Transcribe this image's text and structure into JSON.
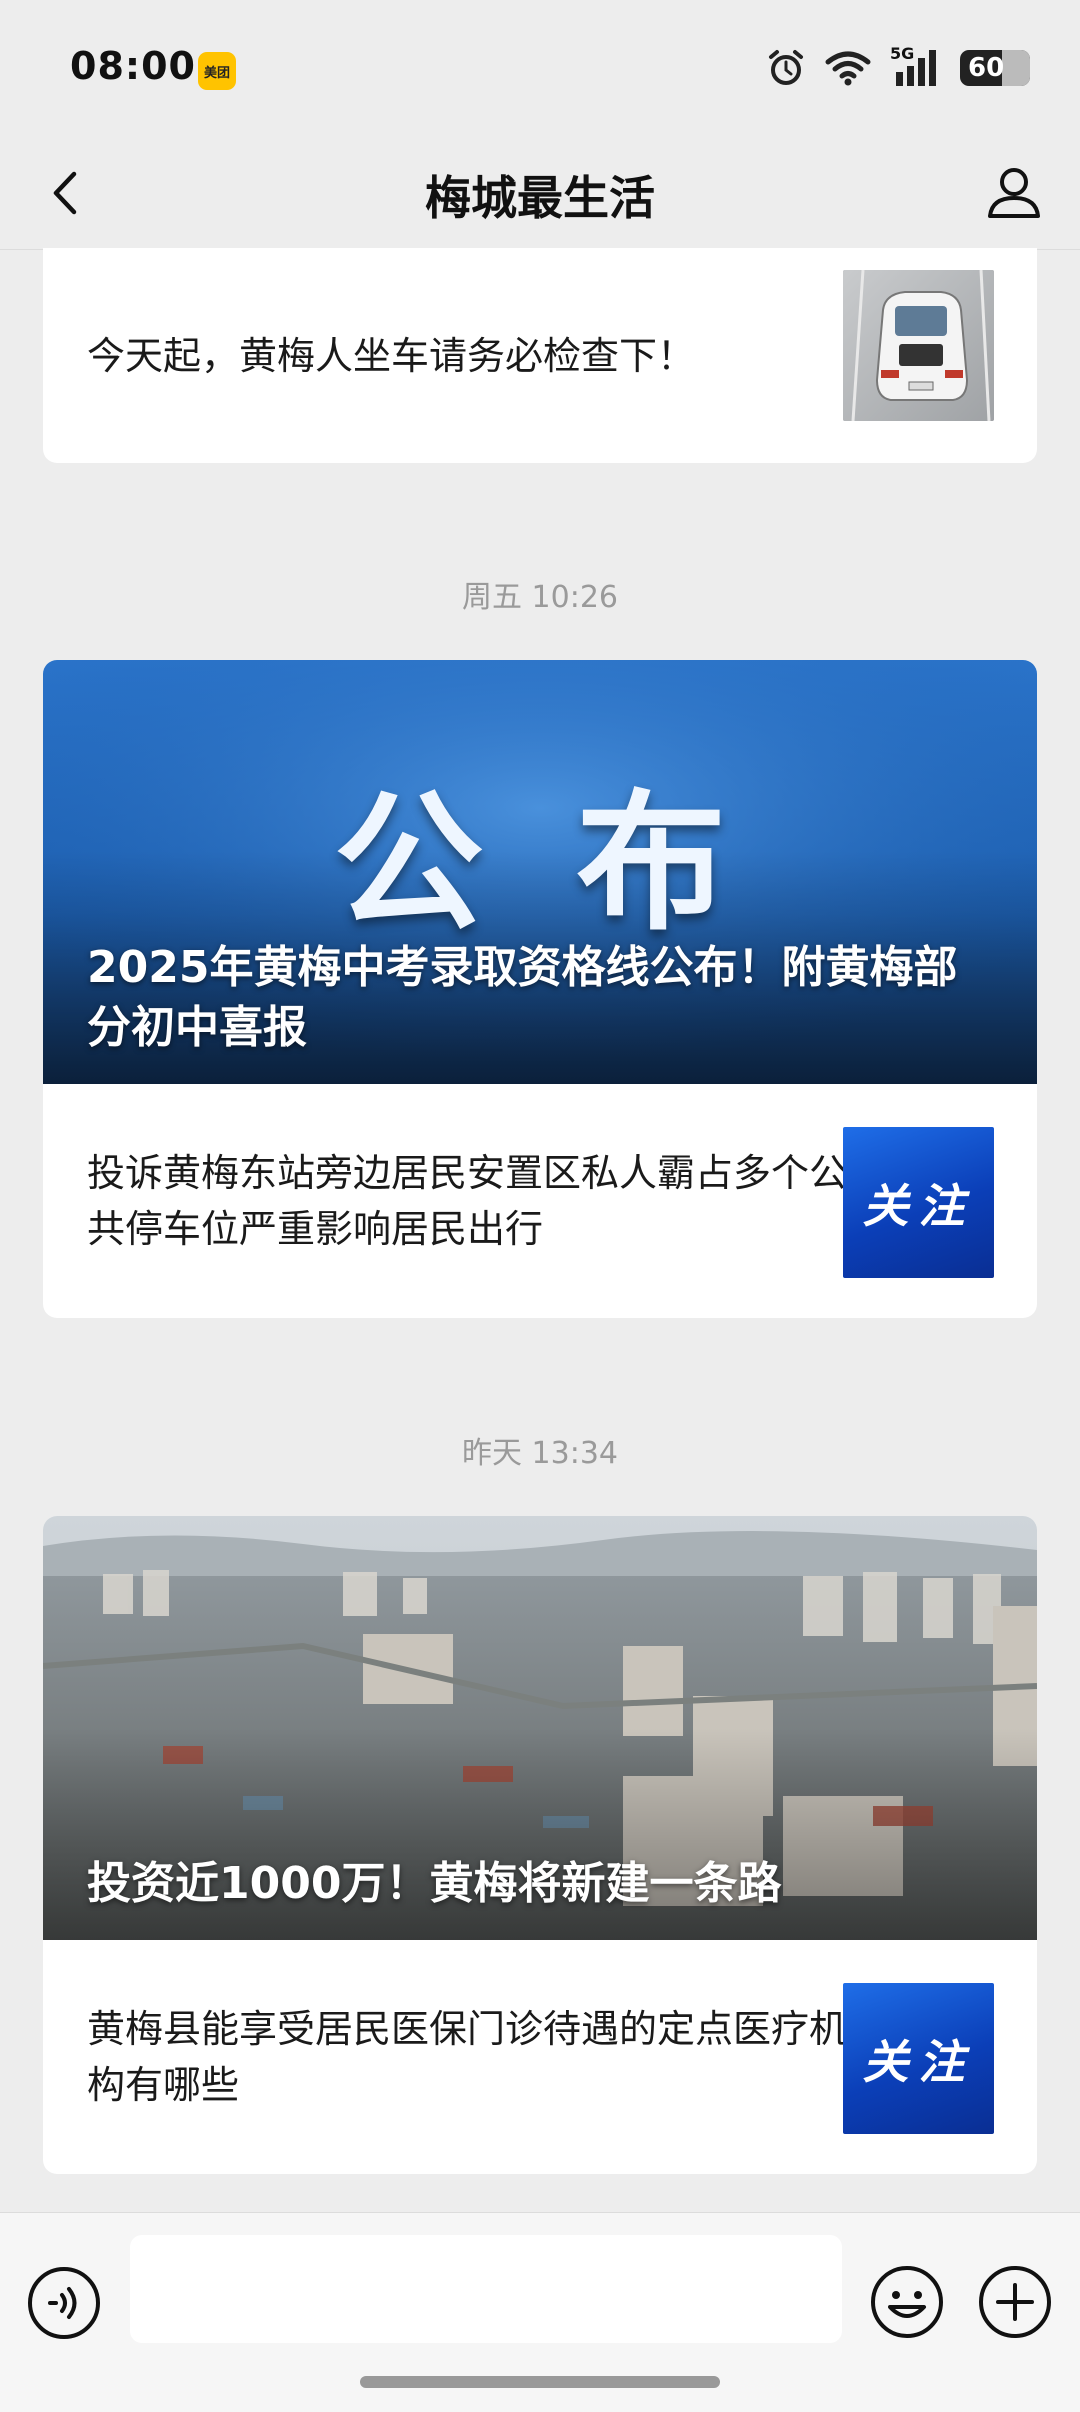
{
  "status_bar": {
    "time": "08:00",
    "app_badge": "美团",
    "network": "5G",
    "battery": "60",
    "icons": [
      "alarm-icon",
      "wifi-icon",
      "signal-icon",
      "battery-icon"
    ]
  },
  "nav": {
    "title": "梅城最生活",
    "back_icon": "chevron-left-icon",
    "profile_icon": "user-icon"
  },
  "messages": [
    {
      "items": [
        {
          "text": "今天起，黄梅人坐车请务必检查下！",
          "thumb": "car-photo"
        }
      ]
    },
    {
      "timestamp": "周五 10:26",
      "cover": {
        "headline": "公 布",
        "title": "2025年黄梅中考录取资格线公布！附黄梅部分初中喜报"
      },
      "items": [
        {
          "text": "投诉黄梅东站旁边居民安置区私人霸占多个公共停车位严重影响居民出行",
          "thumb_text": "关注"
        }
      ]
    },
    {
      "timestamp": "昨天 13:34",
      "cover": {
        "title": "投资近1000万！黄梅将新建一条路"
      },
      "items": [
        {
          "text": "黄梅县能享受居民医保门诊待遇的定点医疗机构有哪些",
          "thumb_text": "关注"
        }
      ]
    }
  ],
  "input_bar": {
    "voice_icon": "voice-icon",
    "emoji_icon": "emoji-icon",
    "plus_icon": "plus-icon",
    "input_value": ""
  },
  "colors": {
    "background": "#ededed",
    "card": "#ffffff",
    "timestamp": "#9a9a9a",
    "accent_blue": "#1f6ee8"
  }
}
